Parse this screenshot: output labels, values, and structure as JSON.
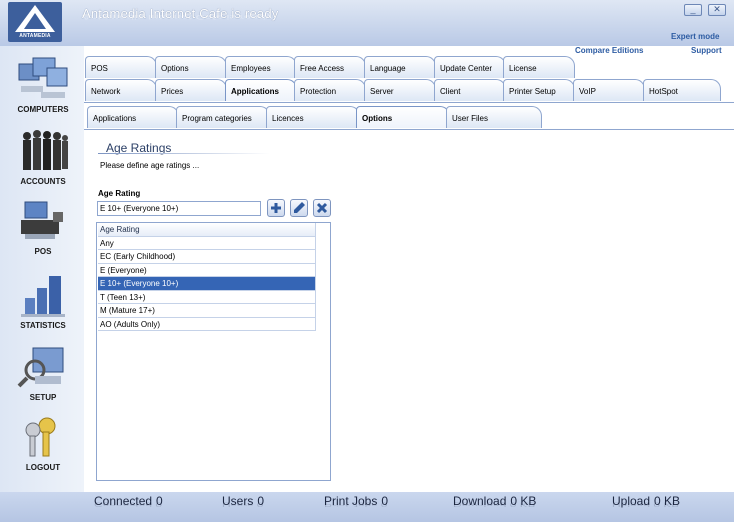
{
  "app": {
    "title": "Antamedia Internet Cafe is ready",
    "logo_text": "ANTAMEDIA"
  },
  "window": {
    "minimize_glyph": "_",
    "close_glyph": "✕"
  },
  "links": {
    "expert_mode": "Expert mode",
    "compare_editions": "Compare Editions",
    "support": "Support"
  },
  "sidebar": {
    "items": [
      {
        "label": "COMPUTERS",
        "icon": "computers-icon"
      },
      {
        "label": "ACCOUNTS",
        "icon": "accounts-icon"
      },
      {
        "label": "POS",
        "icon": "pos-icon"
      },
      {
        "label": "STATISTICS",
        "icon": "statistics-icon"
      },
      {
        "label": "SETUP",
        "icon": "setup-icon"
      },
      {
        "label": "LOGOUT",
        "icon": "keys-icon"
      }
    ]
  },
  "tabs": {
    "row1": [
      "POS",
      "Options",
      "Employees",
      "Free Access",
      "Language",
      "Update Center",
      "License"
    ],
    "row2": [
      "Network",
      "Prices",
      "Applications",
      "Protection",
      "Server",
      "Client",
      "Printer Setup",
      "VoIP",
      "HotSpot"
    ],
    "row3": [
      "Applications",
      "Program categories",
      "Licences",
      "Options",
      "User Files"
    ],
    "row2_active": "Applications",
    "row3_active": "Options"
  },
  "section": {
    "title": "Age Ratings",
    "description": "Please define age ratings ...",
    "field_label": "Age Rating",
    "field_value": "E 10+ (Everyone 10+)"
  },
  "list": {
    "header": "Age Rating",
    "rows": [
      "Any",
      "EC (Early Childhood)",
      "E (Everyone)",
      "E 10+ (Everyone 10+)",
      "T (Teen 13+)",
      "M (Mature 17+)",
      "AO (Adults Only)"
    ],
    "selected": "E 10+ (Everyone 10+)"
  },
  "status": {
    "connected_label": "Connected",
    "connected_value": "0",
    "users_label": "Users",
    "users_value": "0",
    "printjobs_label": "Print Jobs",
    "printjobs_value": "0",
    "download_label": "Download",
    "download_value": "0 KB",
    "upload_label": "Upload",
    "upload_value": "0 KB"
  },
  "colors": {
    "accent": "#3565b5",
    "link": "#2d5ca3",
    "header_gradient_top": "#dfe7f4"
  }
}
